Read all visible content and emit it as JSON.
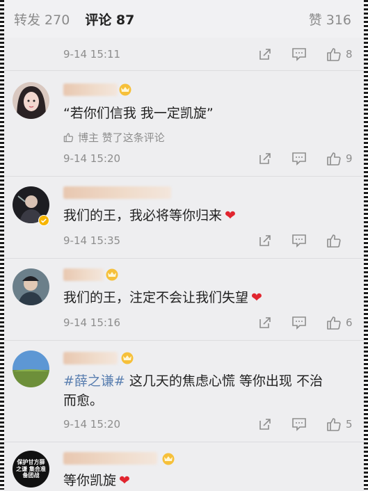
{
  "tabs": {
    "repost": "转发 270",
    "comments": "评论 87",
    "likes": "赞 316"
  },
  "top_meta": {
    "time": "9-14 15:11",
    "like_count": "8"
  },
  "comments": [
    {
      "text": "“若你们信我 我一定凯旋”",
      "liked_by": "博主 赞了这条评论",
      "time": "9-14 15:20",
      "like_count": "9"
    },
    {
      "text": "我们的王，我必将等你归来",
      "time": "9-14 15:35",
      "like_count": ""
    },
    {
      "text": "我们的王，注定不会让我们失望",
      "time": "9-14 15:16",
      "like_count": "6"
    },
    {
      "hashtag": "#薛之谦#",
      "text": " 这几天的焦虑心慌 等你出现 不治",
      "text2": "而愈。",
      "time": "9-14 15:20",
      "like_count": "5"
    },
    {
      "avatar_text": "保护甘方薛之谦 集合准备团战",
      "text": "等你凯旋"
    }
  ],
  "icons": [
    "share-icon",
    "comment-icon",
    "thumbs-up-icon",
    "crown-icon",
    "heart-icon"
  ],
  "colors": {
    "accent": "#ff8200",
    "heart": "#e1252f",
    "hashtag": "#5a7fb0",
    "meta": "#8d8d8d"
  }
}
